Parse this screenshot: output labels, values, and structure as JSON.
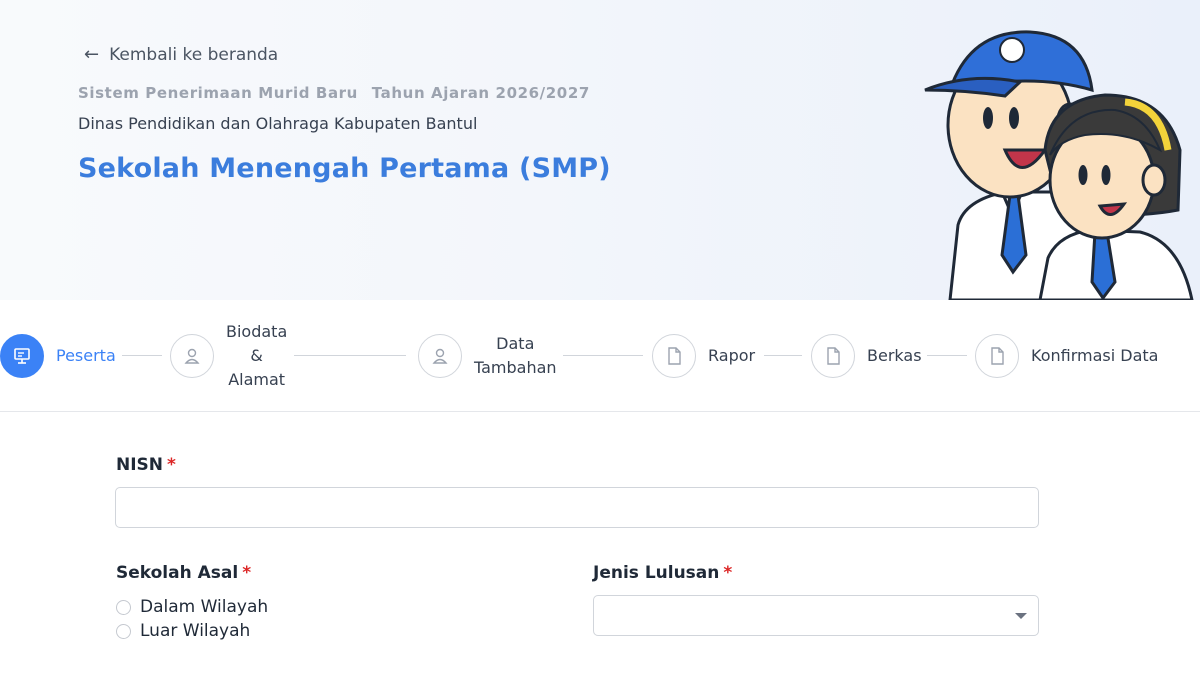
{
  "header": {
    "back_link": "Kembali ke beranda",
    "system_name": "Sistem Penerimaan Murid Baru",
    "academic_year": "Tahun Ajaran 2026/2027",
    "agency": "Dinas Pendidikan dan Olahraga Kabupaten Bantul",
    "level_title": "Sekolah Menengah Pertama (SMP)"
  },
  "stepper": {
    "steps": [
      {
        "label": "Peserta",
        "icon": "presentation-icon",
        "active": true
      },
      {
        "label_lines": [
          "Biodata",
          "&",
          "Alamat"
        ],
        "icon": "user-icon",
        "active": false
      },
      {
        "label_lines": [
          "Data",
          "Tambahan"
        ],
        "icon": "user-icon",
        "active": false
      },
      {
        "label": "Rapor",
        "icon": "file-icon",
        "active": false
      },
      {
        "label": "Berkas",
        "icon": "file-icon",
        "active": false
      },
      {
        "label": "Konfirmasi Data",
        "icon": "file-icon",
        "active": false
      }
    ]
  },
  "form": {
    "nisn": {
      "label": "NISN",
      "required_mark": "*",
      "value": "",
      "placeholder": ""
    },
    "sekolah_asal": {
      "label": "Sekolah Asal",
      "required_mark": "*",
      "options": [
        "Dalam Wilayah",
        "Luar Wilayah"
      ],
      "selected": null
    },
    "jenis_lulusan": {
      "label": "Jenis Lulusan",
      "required_mark": "*",
      "selected": ""
    }
  },
  "colors": {
    "accent": "#3b82f6",
    "title_blue": "#3b7ddd",
    "required": "#dc2626",
    "border": "#d1d5db"
  }
}
